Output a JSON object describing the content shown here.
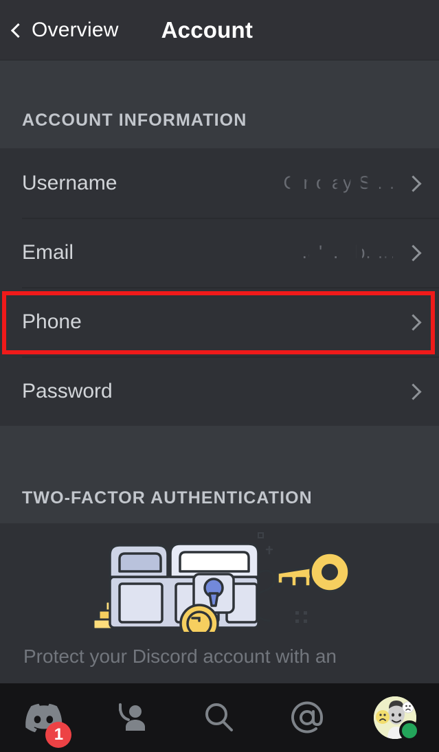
{
  "header": {
    "back_label": "Overview",
    "back_icon": "chevron-left-icon",
    "title": "Account"
  },
  "sections": [
    {
      "id": "account-information",
      "label": "ACCOUNT INFORMATION",
      "rows": [
        {
          "label": "Username",
          "value": "C  r  olay  S  ...",
          "chevron": "chevron-right-icon"
        },
        {
          "label": "Email",
          "value": ".a'  '.  '  b. ...",
          "chevron": "chevron-right-icon"
        },
        {
          "label": "Phone",
          "value": "",
          "chevron": "chevron-right-icon"
        },
        {
          "label": "Password",
          "value": "",
          "chevron": "chevron-right-icon"
        }
      ]
    },
    {
      "id": "two-factor-authentication",
      "label": "TWO-FACTOR AUTHENTICATION",
      "illustration": "treasure-chest-with-key-illustration",
      "description": "Protect your Discord account with an"
    }
  ],
  "annotation": {
    "type": "highlight-rectangle",
    "target": "Phone",
    "color": "#f01a1a"
  },
  "bottom_nav": [
    {
      "id": "home",
      "icon": "discord-home-icon",
      "badge": "1"
    },
    {
      "id": "friends",
      "icon": "friends-icon",
      "badge": ""
    },
    {
      "id": "search",
      "icon": "search-icon",
      "badge": ""
    },
    {
      "id": "mentions",
      "icon": "mentions-at-icon",
      "badge": ""
    },
    {
      "id": "profile",
      "icon": "user-avatar",
      "status": "online"
    }
  ],
  "colors": {
    "app_background": "#2f3136",
    "section_header_background": "#383b40",
    "bottom_nav_background": "#141416",
    "accent_red": "#ed4245",
    "annotation_red": "#f01a1a",
    "online_green": "#23a55a",
    "illustration_gold": "#f6cf5f",
    "illustration_blurple": "#7289da"
  }
}
